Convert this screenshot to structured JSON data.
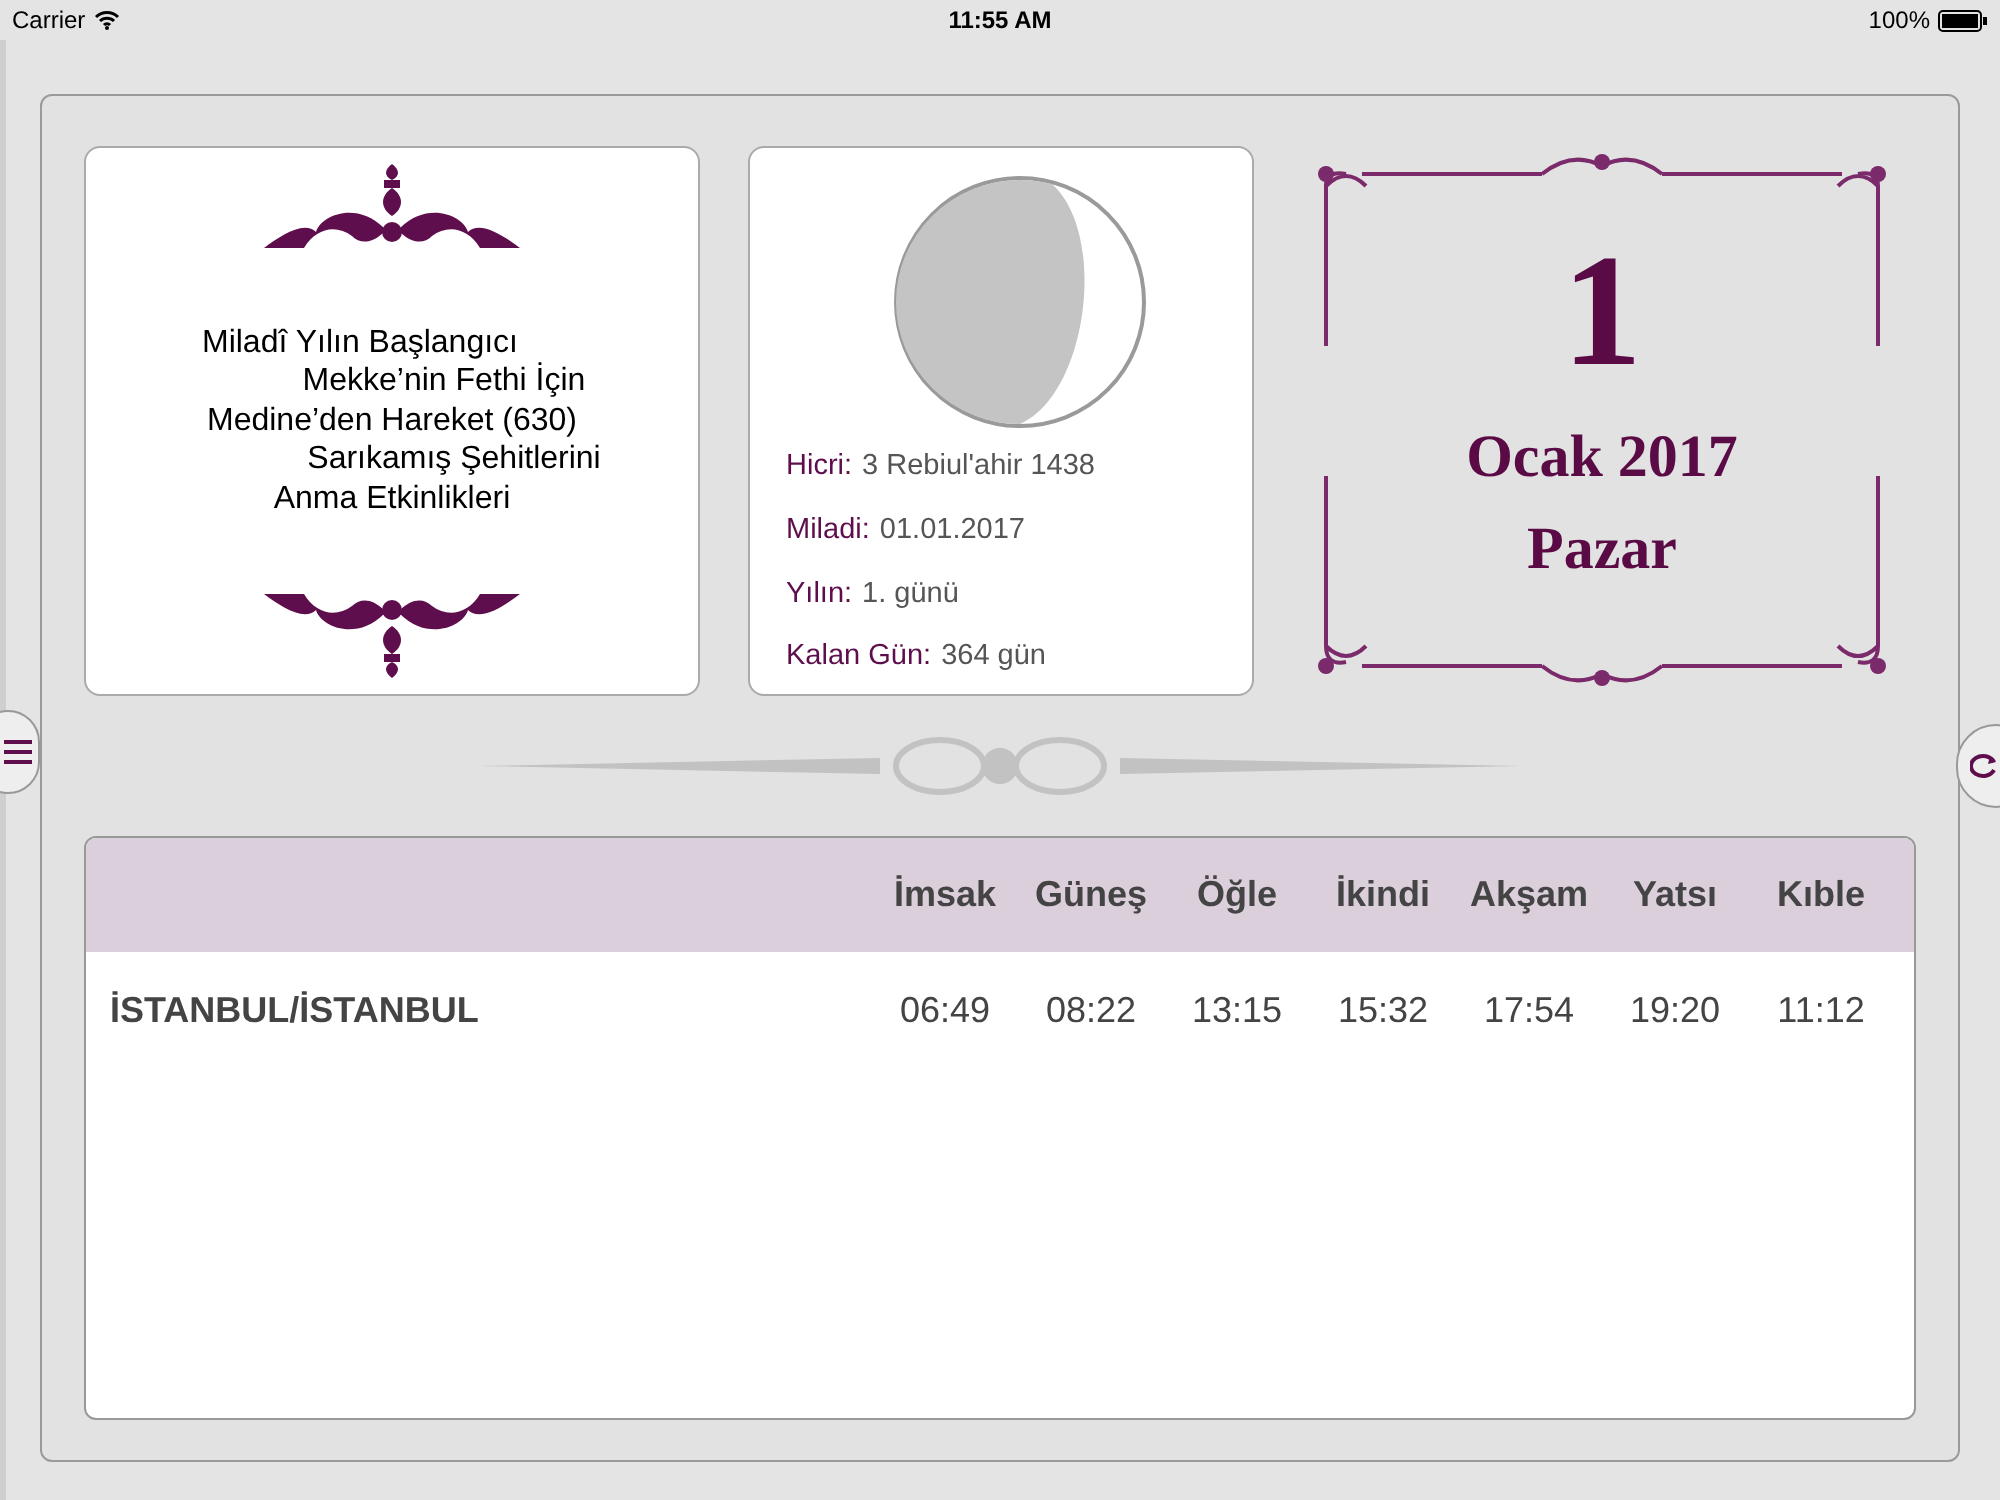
{
  "status_bar": {
    "carrier": "Carrier",
    "time": "11:55 AM",
    "battery": "100%"
  },
  "event_card": {
    "lines": [
      "Miladî Yılın Başlangıcı",
      "Mekke’nin Fethi İçin",
      "Medine’den Hareket (630)",
      "Sarıkamış Şehitlerini",
      "Anma Etkinlikleri"
    ]
  },
  "date_info": {
    "rows": [
      {
        "label": "Hicri:",
        "value": "3 Rebiul'ahir 1438"
      },
      {
        "label": "Miladi:",
        "value": "01.01.2017"
      },
      {
        "label": "Yılın:",
        "value": "1. günü"
      },
      {
        "label": "Kalan Gün:",
        "value": "364 gün"
      }
    ]
  },
  "calendar": {
    "day": "1",
    "month_year": "Ocak 2017",
    "weekday": "Pazar"
  },
  "prayer_table": {
    "columns": [
      "İmsak",
      "Güneş",
      "Öğle",
      "İkindi",
      "Akşam",
      "Yatsı",
      "Kıble"
    ],
    "rows": [
      {
        "city": "İSTANBUL/İSTANBUL",
        "times": [
          "06:49",
          "08:22",
          "13:15",
          "15:32",
          "17:54",
          "19:20",
          "11:12"
        ]
      }
    ]
  }
}
